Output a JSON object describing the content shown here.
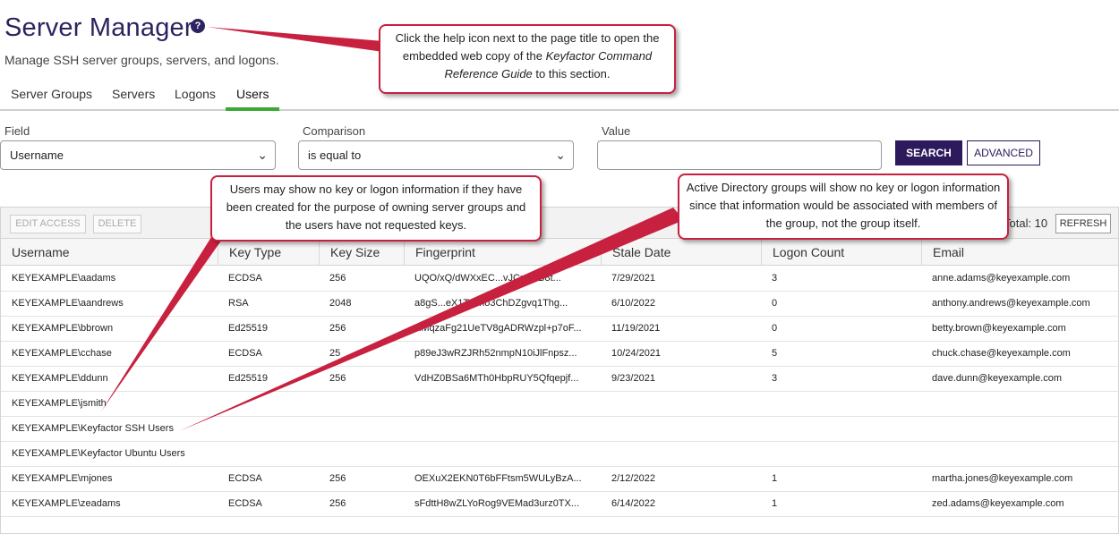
{
  "header": {
    "title": "Server Manager",
    "help_icon": "?",
    "subtitle": "Manage SSH server groups, servers, and logons."
  },
  "tabs": [
    {
      "label": "Server Groups"
    },
    {
      "label": "Servers"
    },
    {
      "label": "Logons"
    },
    {
      "label": "Users"
    }
  ],
  "active_tab": "Users",
  "filters": {
    "field_label": "Field",
    "field_value": "Username",
    "comparison_label": "Comparison",
    "comparison_value": "is equal to",
    "value_label": "Value",
    "value_input": "",
    "search_label": "SEARCH",
    "advanced_label": "ADVANCED"
  },
  "toolbar": {
    "edit_access": "EDIT ACCESS",
    "delete": "DELETE",
    "total": "Total: 10",
    "refresh": "REFRESH"
  },
  "table": {
    "columns": [
      "Username",
      "Key Type",
      "Key Size",
      "Fingerprint",
      "Stale Date",
      "Logon Count",
      "Email"
    ],
    "rows": [
      [
        "KEYEXAMPLE\\aadams",
        "ECDSA",
        "256",
        "UQO/xQ/dWXxEC...vJCprDiB8t...",
        "7/29/2021",
        "3",
        "anne.adams@keyexample.com"
      ],
      [
        "KEYEXAMPLE\\aandrews",
        "RSA",
        "2048",
        "a8gS...eX1TCmo3ChDZgvq1Thg...",
        "6/10/2022",
        "0",
        "anthony.andrews@keyexample.com"
      ],
      [
        "KEYEXAMPLE\\bbrown",
        "Ed25519",
        "256",
        "XMqzaFg21UeTV8gADRWzpl+p7oF...",
        "11/19/2021",
        "0",
        "betty.brown@keyexample.com"
      ],
      [
        "KEYEXAMPLE\\cchase",
        "ECDSA",
        "25",
        "p89eJ3wRZJRh52nmpN10iJlFnpsz...",
        "10/24/2021",
        "5",
        "chuck.chase@keyexample.com"
      ],
      [
        "KEYEXAMPLE\\ddunn",
        "Ed25519",
        "256",
        "VdHZ0BSa6MTh0HbpRUY5Qfqepjf...",
        "9/23/2021",
        "3",
        "dave.dunn@keyexample.com"
      ],
      [
        "KEYEXAMPLE\\jsmith",
        "",
        "",
        "",
        "",
        "",
        ""
      ],
      [
        "KEYEXAMPLE\\Keyfactor SSH Users",
        "",
        "",
        "",
        "",
        "",
        ""
      ],
      [
        "KEYEXAMPLE\\Keyfactor Ubuntu Users",
        "",
        "",
        "",
        "",
        "",
        ""
      ],
      [
        "KEYEXAMPLE\\mjones",
        "ECDSA",
        "256",
        "OEXuX2EKN0T6bFFtsm5WULyBzA...",
        "2/12/2022",
        "1",
        "martha.jones@keyexample.com"
      ],
      [
        "KEYEXAMPLE\\zeadams",
        "ECDSA",
        "256",
        "sFdttH8wZLYoRog9VEMad3urz0TX...",
        "6/14/2022",
        "1",
        "zed.adams@keyexample.com"
      ]
    ]
  },
  "callouts": {
    "help_part1": "Click the help icon next to the page title to open the embedded web copy of the ",
    "help_italic": "Keyfactor Command Reference Guide",
    "help_part2": " to this section.",
    "users_note": "Users may show no key or logon information if they have been created for the purpose of owning server groups and the users have not requested keys.",
    "ad_note": "Active Directory groups will show no key or logon information since that information would be associated with members of the group, not the group itself."
  },
  "colors": {
    "brand": "#2d2360",
    "active_tab": "#3aa935",
    "callout_border": "#c8203f"
  }
}
